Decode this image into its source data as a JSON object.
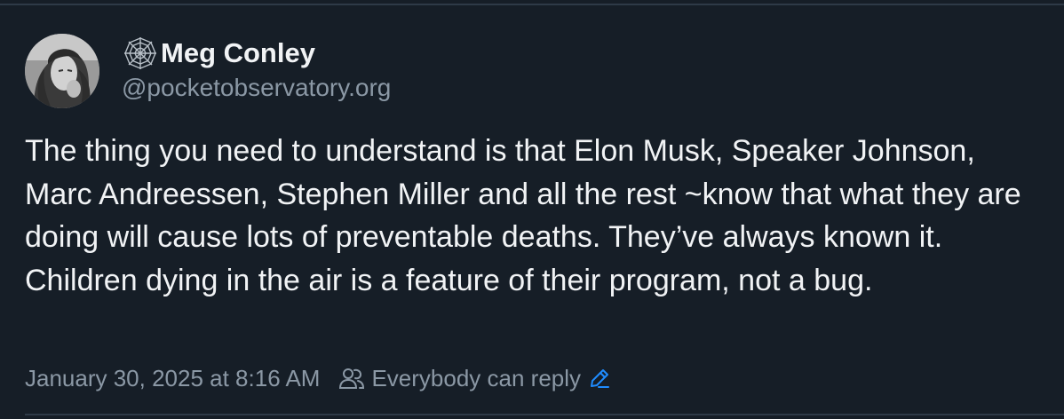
{
  "post": {
    "author": {
      "display_name": "Meg Conley",
      "handle": "@pocketobservatory.org",
      "name_prefix_icon": "spider-web-icon",
      "avatar_icon": "user-avatar"
    },
    "text": "The thing you need to understand is that Elon Musk, Speaker Johnson, Marc Andreessen, Stephen Miller and all the rest ~know that what they are doing will cause lots of preventable deaths. They’ve always known it. Children dying in the air is a feature of their program, not a bug.",
    "timestamp": "January 30, 2025 at 8:16 AM",
    "reply_setting": {
      "label": "Everybody can reply",
      "icon": "people-icon",
      "edit_icon": "pencil-icon"
    }
  },
  "colors": {
    "background": "#161e27",
    "text_primary": "#f1f3f5",
    "text_secondary": "#8b98a5",
    "accent": "#1f8cff",
    "border": "#2e3a47"
  }
}
